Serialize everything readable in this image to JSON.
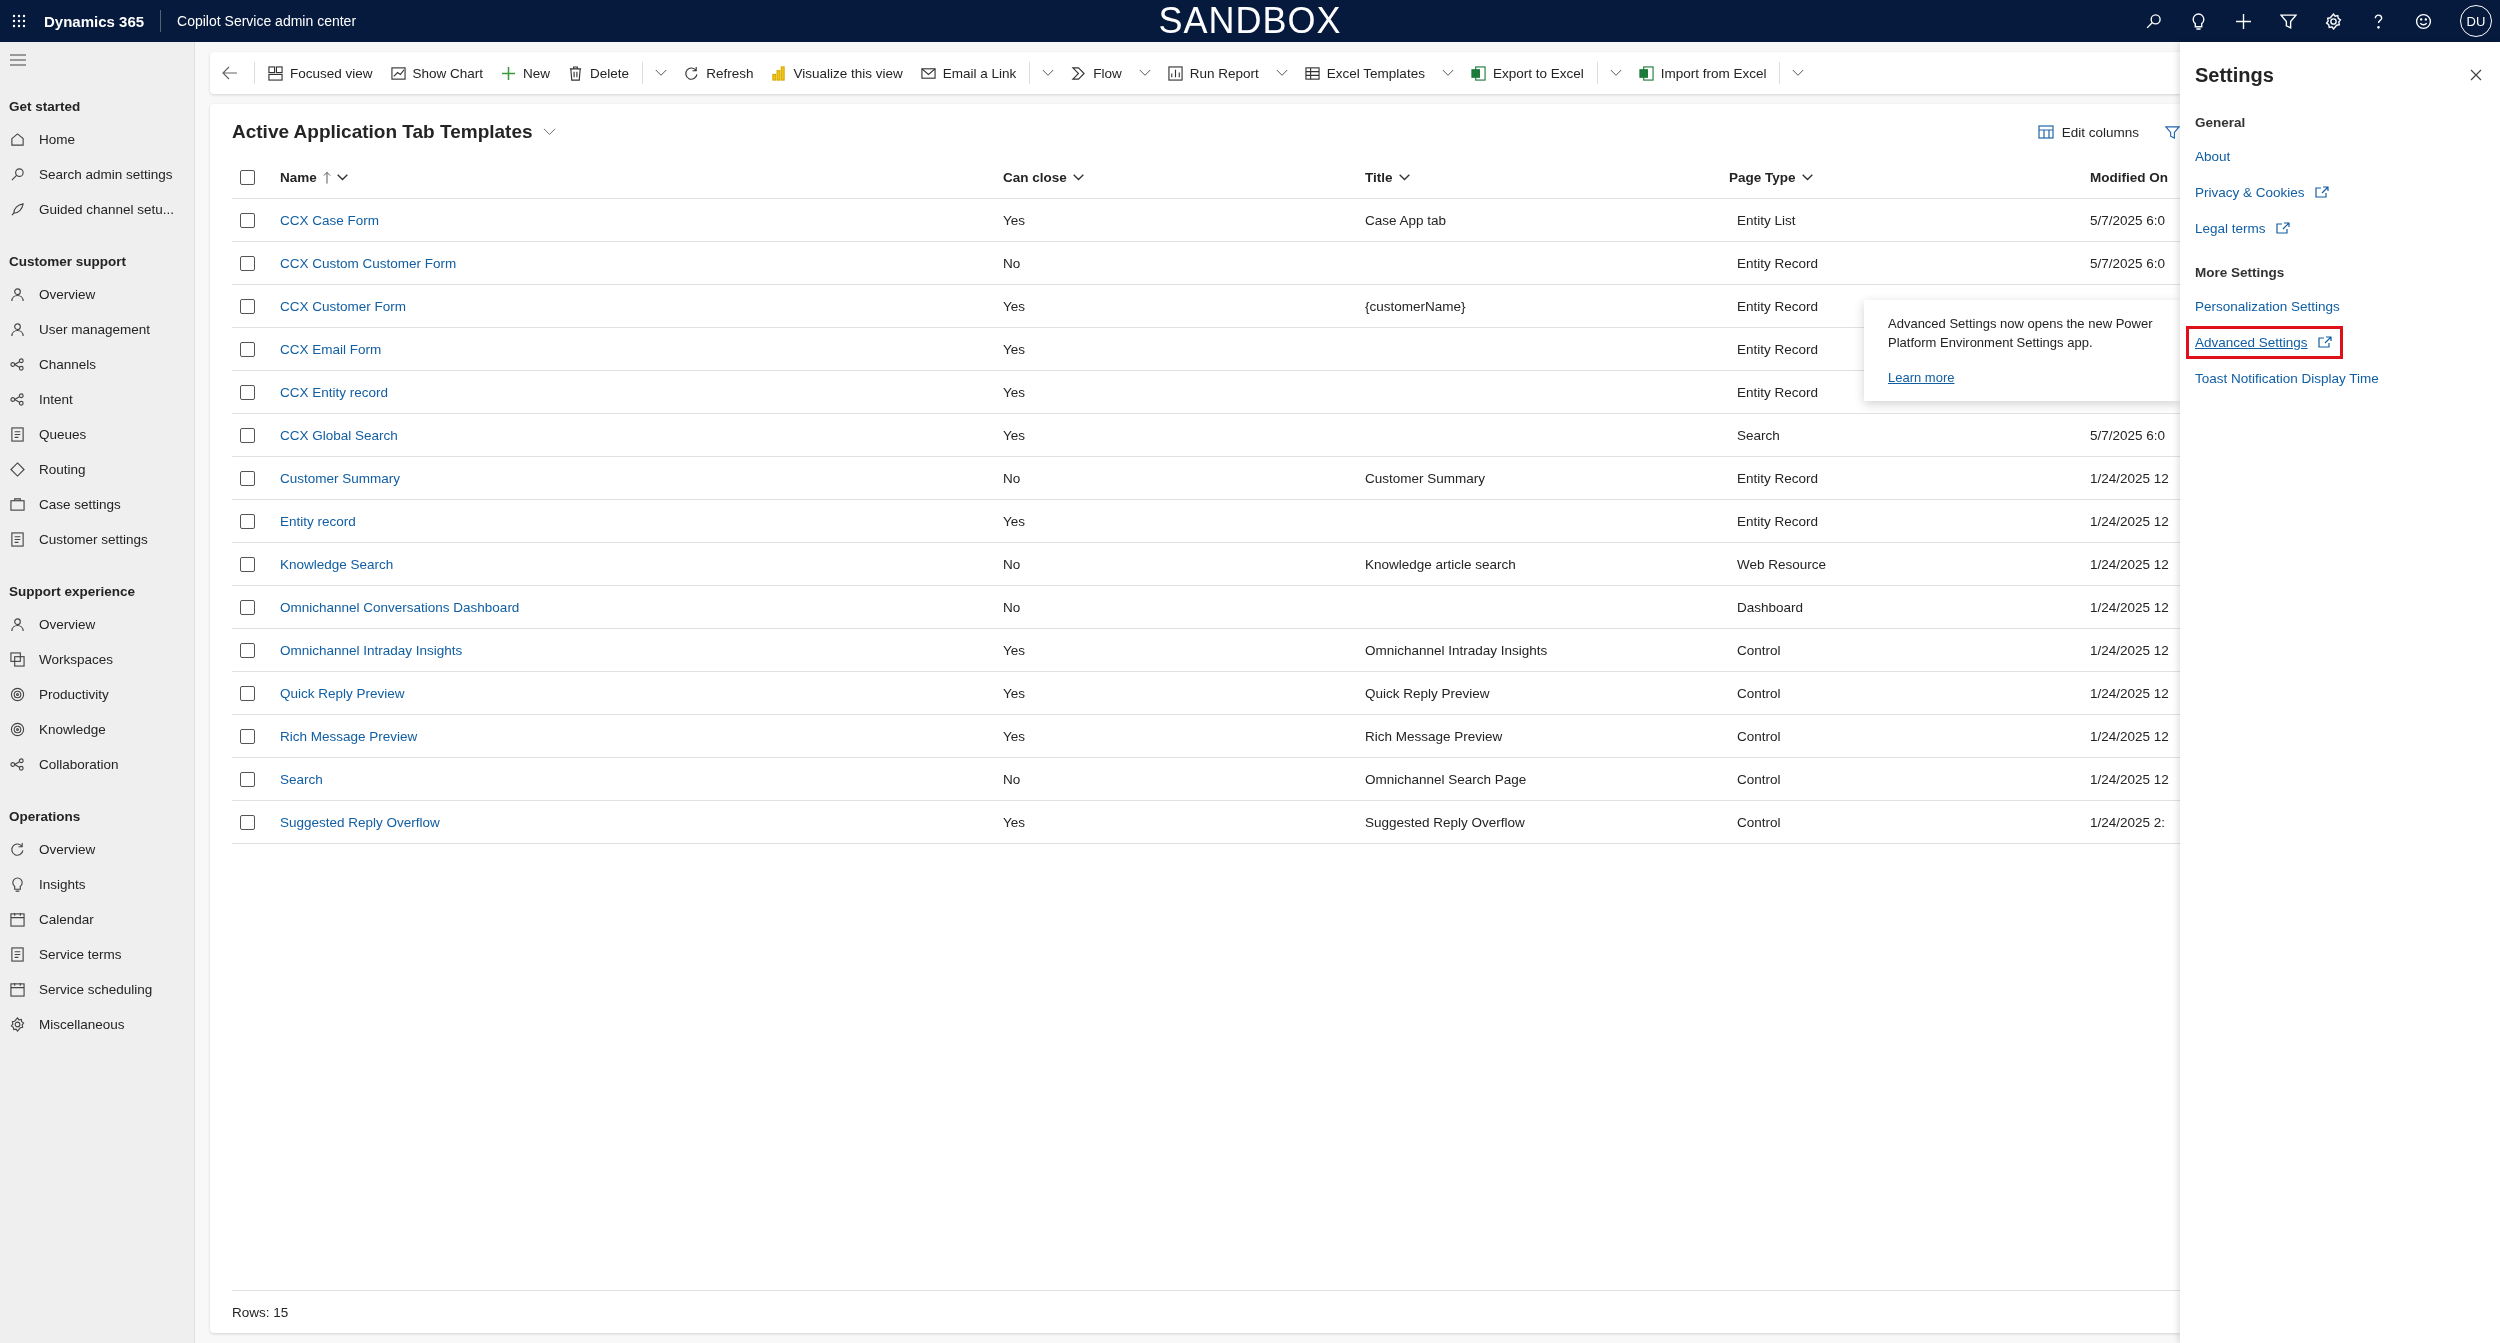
{
  "top_bar": {
    "app_name": "Dynamics 365",
    "area_name": "Copilot Service admin center",
    "environment": "SANDBOX",
    "avatar": "DU"
  },
  "sidebar": {
    "groups": [
      {
        "title": "Get started",
        "items": [
          {
            "label": "Home"
          },
          {
            "label": "Search admin settings"
          },
          {
            "label": "Guided channel setu..."
          }
        ]
      },
      {
        "title": "Customer support",
        "items": [
          {
            "label": "Overview"
          },
          {
            "label": "User management"
          },
          {
            "label": "Channels"
          },
          {
            "label": "Intent"
          },
          {
            "label": "Queues"
          },
          {
            "label": "Routing"
          },
          {
            "label": "Case settings"
          },
          {
            "label": "Customer settings"
          }
        ]
      },
      {
        "title": "Support experience",
        "items": [
          {
            "label": "Overview"
          },
          {
            "label": "Workspaces"
          },
          {
            "label": "Productivity"
          },
          {
            "label": "Knowledge"
          },
          {
            "label": "Collaboration"
          }
        ]
      },
      {
        "title": "Operations",
        "items": [
          {
            "label": "Overview"
          },
          {
            "label": "Insights"
          },
          {
            "label": "Calendar"
          },
          {
            "label": "Service terms"
          },
          {
            "label": "Service scheduling"
          },
          {
            "label": "Miscellaneous"
          }
        ]
      }
    ]
  },
  "toolbar": [
    {
      "label": "Focused view",
      "kind": "button"
    },
    {
      "label": "Show Chart",
      "kind": "button"
    },
    {
      "label": "New",
      "kind": "button"
    },
    {
      "label": "Delete",
      "kind": "split"
    },
    {
      "label": "Refresh",
      "kind": "button"
    },
    {
      "label": "Visualize this view",
      "kind": "button"
    },
    {
      "label": "Email a Link",
      "kind": "split"
    },
    {
      "label": "Flow",
      "kind": "dropdown"
    },
    {
      "label": "Run Report",
      "kind": "dropdown"
    },
    {
      "label": "Excel Templates",
      "kind": "dropdown"
    },
    {
      "label": "Export to Excel",
      "kind": "split"
    },
    {
      "label": "Import from Excel",
      "kind": "split"
    }
  ],
  "view": {
    "title": "Active Application Tab Templates",
    "edit_columns": "Edit columns"
  },
  "table": {
    "select_all": {
      "checked": false
    },
    "columns": [
      {
        "label": "Name",
        "sorted_ascending": true,
        "menu": true
      },
      {
        "label": "Can close",
        "sorted_ascending": false,
        "menu": true
      },
      {
        "label": "Title",
        "sorted_ascending": false,
        "menu": true
      },
      {
        "label": "Page Type",
        "sorted_ascending": false,
        "menu": true
      },
      {
        "label": "Modified On",
        "sorted_ascending": false,
        "menu": false
      }
    ],
    "rows": [
      {
        "checked": false,
        "name": "CCX Case Form",
        "can_close": "Yes",
        "title": "Case App tab",
        "page_type": "Entity List",
        "modified": "5/7/2025 6:0"
      },
      {
        "checked": false,
        "name": "CCX Custom Customer Form",
        "can_close": "No",
        "page_type": "Entity Record",
        "modified": "5/7/2025 6:0"
      },
      {
        "checked": false,
        "name": "CCX Customer Form",
        "can_close": "Yes",
        "title": "{customerName}",
        "page_type": "Entity Record"
      },
      {
        "checked": false,
        "name": "CCX Email Form",
        "can_close": "Yes",
        "page_type": "Entity Record"
      },
      {
        "checked": false,
        "name": "CCX Entity record",
        "can_close": "Yes",
        "page_type": "Entity Record"
      },
      {
        "checked": false,
        "name": "CCX Global Search",
        "can_close": "Yes",
        "page_type": "Search",
        "modified": "5/7/2025 6:0"
      },
      {
        "checked": false,
        "name": "Customer Summary",
        "can_close": "No",
        "title": "Customer Summary",
        "page_type": "Entity Record",
        "modified": "1/24/2025 12"
      },
      {
        "checked": false,
        "name": "Entity record",
        "can_close": "Yes",
        "page_type": "Entity Record",
        "modified": "1/24/2025 12"
      },
      {
        "checked": false,
        "name": "Knowledge Search",
        "can_close": "No",
        "title": "Knowledge article search",
        "page_type": "Web Resource",
        "modified": "1/24/2025 12"
      },
      {
        "checked": false,
        "name": "Omnichannel Conversations Dashboard",
        "can_close": "No",
        "page_type": "Dashboard",
        "modified": "1/24/2025 12"
      },
      {
        "checked": false,
        "name": "Omnichannel Intraday Insights",
        "can_close": "Yes",
        "title": "Omnichannel Intraday Insights",
        "page_type": "Control",
        "modified": "1/24/2025 12"
      },
      {
        "checked": false,
        "name": "Quick Reply Preview",
        "can_close": "Yes",
        "title": "Quick Reply Preview",
        "page_type": "Control",
        "modified": "1/24/2025 12"
      },
      {
        "checked": false,
        "name": "Rich Message Preview",
        "can_close": "Yes",
        "title": "Rich Message Preview",
        "page_type": "Control",
        "modified": "1/24/2025 12"
      },
      {
        "checked": false,
        "name": "Search",
        "can_close": "No",
        "title": "Omnichannel Search Page",
        "page_type": "Control",
        "modified": "1/24/2025 12"
      },
      {
        "checked": false,
        "name": "Suggested Reply Overflow",
        "can_close": "Yes",
        "title": "Suggested Reply Overflow",
        "page_type": "Control",
        "modified": "1/24/2025 2:"
      }
    ],
    "footer": "Rows: 15"
  },
  "callout": {
    "text": "Advanced Settings now opens the new Power Platform Environment Settings app.",
    "link": "Learn more"
  },
  "settings_panel": {
    "title": "Settings",
    "sections": [
      {
        "title": "General",
        "items": [
          {
            "label": "About",
            "external": false,
            "highlighted": false
          },
          {
            "label": "Privacy & Cookies",
            "external": true,
            "highlighted": false
          },
          {
            "label": "Legal terms",
            "external": true,
            "highlighted": false
          }
        ]
      },
      {
        "title": "More Settings",
        "items": [
          {
            "label": "Personalization Settings",
            "external": false,
            "highlighted": false
          },
          {
            "label": "Advanced Settings",
            "external": true,
            "highlighted": true
          },
          {
            "label": "Toast Notification Display Time",
            "external": false,
            "highlighted": false
          }
        ]
      }
    ]
  }
}
